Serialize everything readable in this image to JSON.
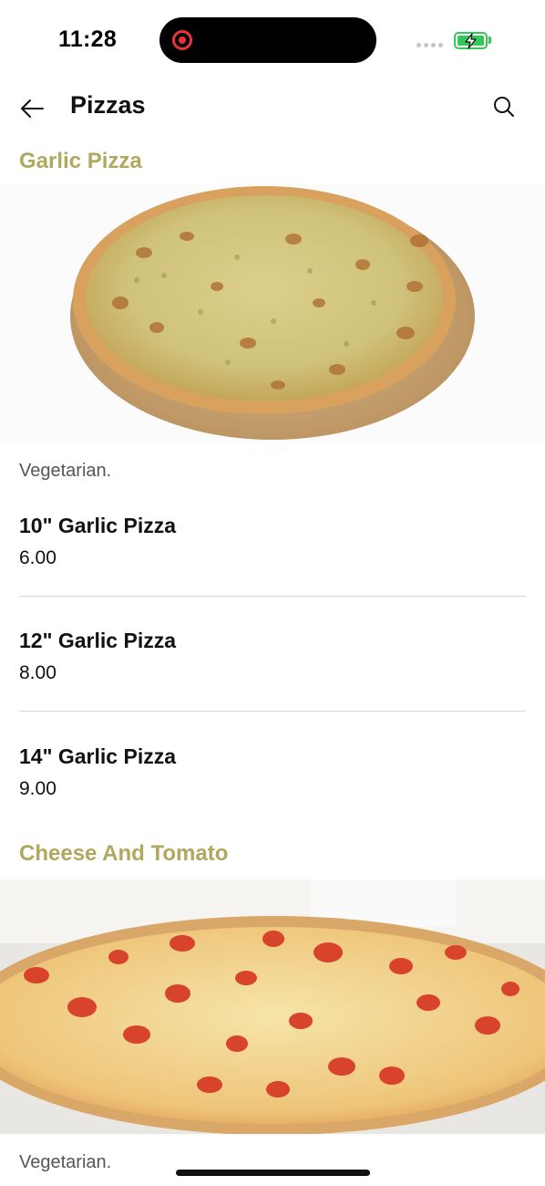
{
  "status_bar": {
    "time": "11:28"
  },
  "header": {
    "title": "Pizzas"
  },
  "sections": [
    {
      "title": "Garlic Pizza",
      "description": "Vegetarian.",
      "items": [
        {
          "name": "10\" Garlic Pizza",
          "price": "6.00"
        },
        {
          "name": "12\" Garlic Pizza",
          "price": "8.00"
        },
        {
          "name": "14\" Garlic Pizza",
          "price": "9.00"
        }
      ]
    },
    {
      "title": "Cheese And Tomato",
      "description": "Vegetarian."
    }
  ],
  "colors": {
    "section_title": "#b0a85e",
    "battery": "#34c759",
    "recording": "#e8333a"
  }
}
